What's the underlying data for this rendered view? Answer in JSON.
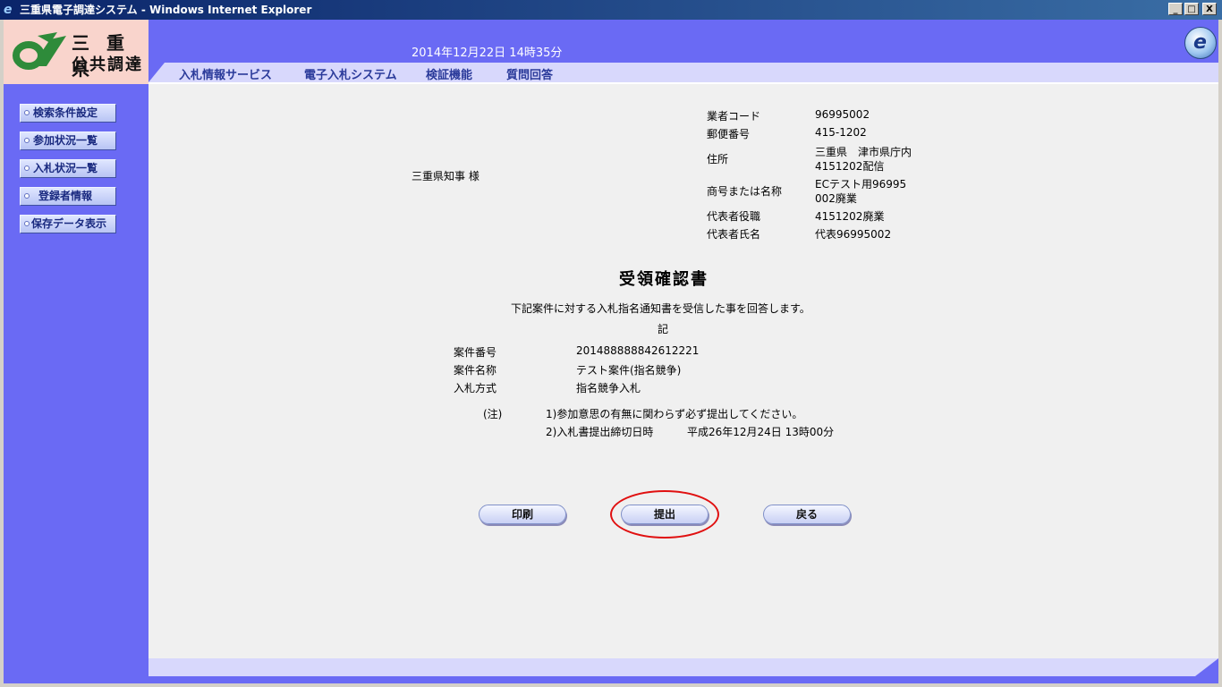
{
  "window": {
    "title": "三重県電子調達システム - Windows Internet Explorer",
    "controls": [
      "_",
      "□",
      "X"
    ]
  },
  "logo": {
    "line1": "三 重 県",
    "line2": "公共調達"
  },
  "header": {
    "datetime": "2014年12月22日 14時35分",
    "nav": [
      "入札情報サービス",
      "電子入札システム",
      "検証機能",
      "質問回答"
    ]
  },
  "sidebar": {
    "items": [
      "検索条件設定",
      "参加状況一覧",
      "入札状況一覧",
      "登録者情報",
      "保存データ表示"
    ]
  },
  "document": {
    "recipient": "三重県知事 様",
    "company": [
      {
        "label": "業者コード",
        "value": "96995002"
      },
      {
        "label": "郵便番号",
        "value": "415-1202"
      },
      {
        "label": "住所",
        "value": "三重県　津市県庁内",
        "value2": "4151202配信"
      },
      {
        "label": "商号または名称",
        "value": "ECテスト用96995",
        "value2": "002廃業"
      },
      {
        "label": "代表者役職",
        "value": "4151202廃業"
      },
      {
        "label": "代表者氏名",
        "value": "代表96995002"
      }
    ],
    "title": "受領確認書",
    "intro": "下記案件に対する入札指名通知書を受信した事を回答します。",
    "ki": "記",
    "case": [
      {
        "label": "案件番号",
        "value": "2014888888426122​21"
      },
      {
        "label": "案件名称",
        "value": "テスト案件(指名競争)"
      },
      {
        "label": "入札方式",
        "value": "指名競争入札"
      }
    ],
    "note_label": "(注)",
    "note1": "1)参加意思の有無に関わらず必ず提出してください。",
    "note2_label": "2)入札書提出締切日時",
    "note2_value": "平成26年12月24日 13時00分"
  },
  "buttons": {
    "print": "印刷",
    "submit": "提出",
    "back": "戻る"
  },
  "colors": {
    "accent": "#6a6af4",
    "highlight": "#e01010"
  }
}
